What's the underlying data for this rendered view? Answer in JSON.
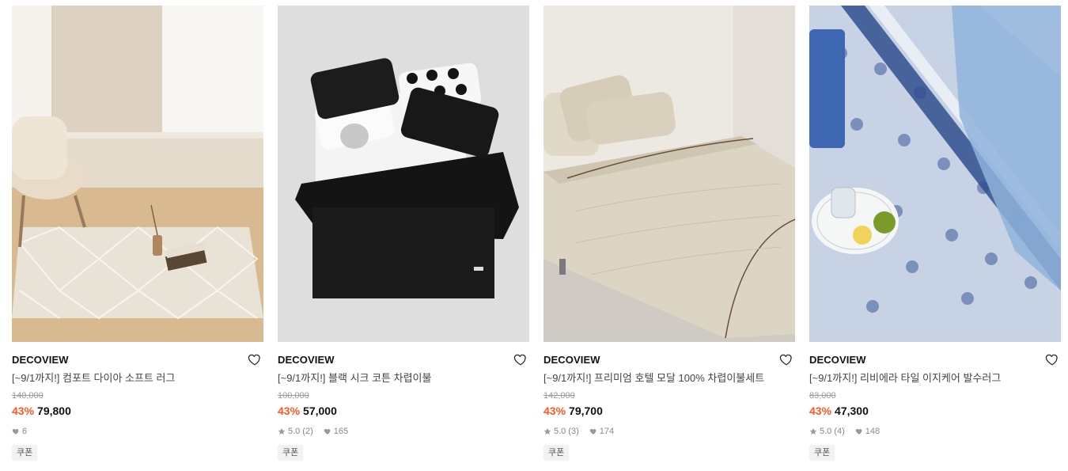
{
  "products": [
    {
      "brand": "DECOVIEW",
      "name": "[~9/1까지!] 컴포트 다이아 소프트 러그",
      "original_price": "140,000",
      "discount": "43%",
      "price": "79,800",
      "rating": "",
      "reviews": "",
      "likes": "6",
      "badge": "쿠폰",
      "image": "beige diamond rug with armchair",
      "has_rating": false
    },
    {
      "brand": "DECOVIEW",
      "name": "[~9/1까지!] 블랙 시크 코튼 차렵이불",
      "original_price": "100,000",
      "discount": "43%",
      "price": "57,000",
      "rating": "5.0",
      "reviews": "(2)",
      "likes": "165",
      "badge": "쿠폰",
      "image": "black bedding set with heart pillows",
      "has_rating": true
    },
    {
      "brand": "DECOVIEW",
      "name": "[~9/1까지!] 프리미엄 호텔 모달 100% 차렵이불세트",
      "original_price": "142,000",
      "discount": "43%",
      "price": "79,700",
      "rating": "5.0",
      "reviews": "(3)",
      "likes": "174",
      "badge": "쿠폰",
      "image": "beige hotel bedding on bed",
      "has_rating": true
    },
    {
      "brand": "DECOVIEW",
      "name": "[~9/1까지!] 리비에라 타일 이지케어 발수러그",
      "original_price": "83,000",
      "discount": "43%",
      "price": "47,300",
      "rating": "5.0",
      "reviews": "(4)",
      "likes": "148",
      "badge": "쿠폰",
      "image": "blue tile pattern rug with plate",
      "has_rating": true
    }
  ],
  "colors": {
    "discount": "#ff5a1f",
    "muted": "#888888",
    "badge_bg": "#f2f2f2"
  }
}
